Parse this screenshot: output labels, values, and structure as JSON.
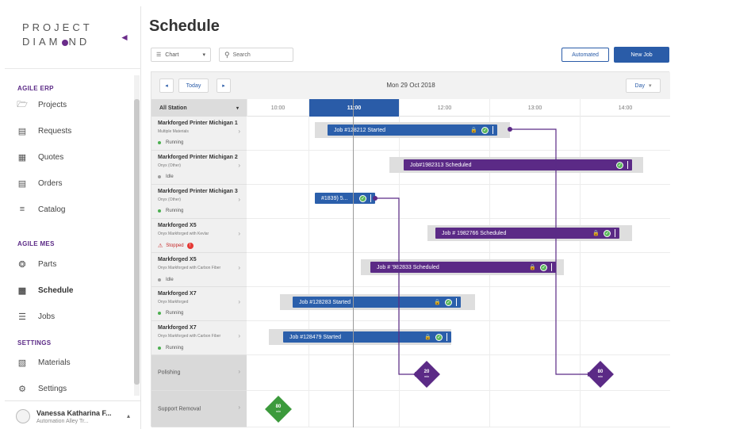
{
  "app": {
    "logo_line1": "PROJECT",
    "logo_line2a": "DIAM",
    "logo_line2b": "ND"
  },
  "sidebar": {
    "sections": [
      {
        "title": "AGILE ERP"
      },
      {
        "title": "AGILE MES"
      },
      {
        "title": "SETTINGS"
      }
    ],
    "items": [
      {
        "label": "Projects",
        "icon": "folder-icon"
      },
      {
        "label": "Requests",
        "icon": "request-icon"
      },
      {
        "label": "Quotes",
        "icon": "quote-icon"
      },
      {
        "label": "Orders",
        "icon": "orders-icon"
      },
      {
        "label": "Catalog",
        "icon": "catalog-icon"
      },
      {
        "label": "Parts",
        "icon": "parts-icon"
      },
      {
        "label": "Schedule",
        "icon": "calendar-icon"
      },
      {
        "label": "Jobs",
        "icon": "jobs-icon"
      },
      {
        "label": "Materials",
        "icon": "materials-icon"
      },
      {
        "label": "Settings",
        "icon": "gear-icon"
      }
    ],
    "user": {
      "name": "Vanessa Katharina F...",
      "org": "Automation Alley Tr..."
    }
  },
  "page": {
    "title": "Schedule"
  },
  "toolbar": {
    "view_select": "Chart",
    "search_placeholder": "Search",
    "automated_label": "Automated",
    "new_job_label": "New Job"
  },
  "scheduler": {
    "today_label": "Today",
    "date": "Mon 29 Oct 2018",
    "range_select": "Day",
    "station_filter": "All Station",
    "times": [
      "10:00",
      "11:00",
      "12:00",
      "13:00",
      "14:00"
    ],
    "active_time_index": 1,
    "rows": [
      {
        "name": "Markforged Printer Michigan 1",
        "sub": "Multiple Materials",
        "status": "Running",
        "status_color": "#4caf50"
      },
      {
        "name": "Markforged Printer Michigan 2",
        "sub": "Onyx (Other)",
        "status": "Idle",
        "status_color": "#9e9e9e"
      },
      {
        "name": "Markforged Printer Michigan 3",
        "sub": "Onyx (Other)",
        "status": "Running",
        "status_color": "#4caf50"
      },
      {
        "name": "Markforged X5",
        "sub": "Onyx Markforged with Kevlar",
        "status": "Stopped",
        "status_color": "#e53935"
      },
      {
        "name": "Markforged X5",
        "sub": "Onyx Markforged with Carbon Fiber",
        "status": "Idle",
        "status_color": "#9e9e9e"
      },
      {
        "name": "Markforged X7",
        "sub": "Onyx Markforged",
        "status": "Running",
        "status_color": "#4caf50"
      },
      {
        "name": "Markforged X7",
        "sub": "Onyx Markforged with Carbon Fiber",
        "status": "Running",
        "status_color": "#4caf50"
      },
      {
        "name": "Polishing"
      },
      {
        "name": "Support Removal"
      }
    ],
    "jobs": [
      {
        "label": "Job #128212 Started",
        "color": "blue"
      },
      {
        "label": "Job#1982313 Scheduled",
        "color": "purple"
      },
      {
        "label": "#1839) 5...",
        "color": "blue"
      },
      {
        "label": "Job # 1982766 Scheduled",
        "color": "purple"
      },
      {
        "label": "Job # '982833 Scheduled",
        "color": "purple"
      },
      {
        "label": "Job #128283 Started",
        "color": "blue"
      },
      {
        "label": "Job #128479 Started",
        "color": "blue"
      }
    ],
    "milestones": [
      {
        "value": "20",
        "unit": "min",
        "color": "#5b2a86"
      },
      {
        "value": "80",
        "unit": "min",
        "color": "#5b2a86"
      },
      {
        "value": "80",
        "unit": "min",
        "color": "#3c9a3c"
      }
    ],
    "colors": {
      "blue": "#2b5fab",
      "purple": "#5b2a86",
      "accent": "#2a5ca8"
    }
  }
}
